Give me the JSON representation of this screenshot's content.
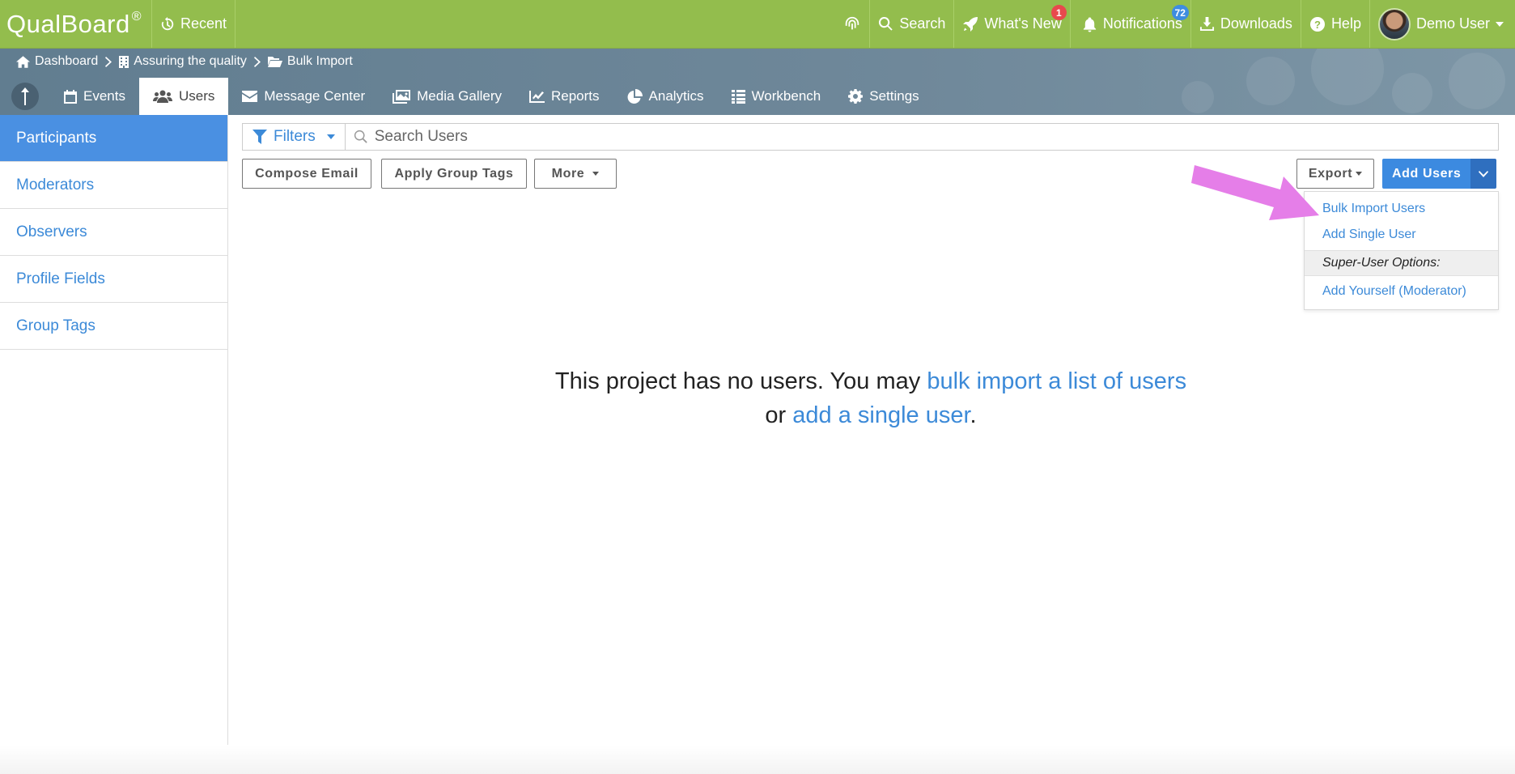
{
  "brand": {
    "name": "QualBoard",
    "mark": "®"
  },
  "topbar": {
    "recent": "Recent",
    "search": "Search",
    "whats_new": "What's New",
    "whats_new_badge": "1",
    "notifications": "Notifications",
    "notifications_badge": "72",
    "downloads": "Downloads",
    "help": "Help",
    "user": "Demo User"
  },
  "breadcrumb": [
    "Dashboard",
    "Assuring the quality",
    "Bulk Import"
  ],
  "nav": {
    "tabs": [
      "Events",
      "Users",
      "Message Center",
      "Media Gallery",
      "Reports",
      "Analytics",
      "Workbench",
      "Settings"
    ],
    "active": "Users"
  },
  "sidebar": {
    "items": [
      "Participants",
      "Moderators",
      "Observers",
      "Profile Fields",
      "Group Tags"
    ],
    "active": "Participants"
  },
  "toolbar": {
    "filters": "Filters",
    "search_placeholder": "Search Users",
    "compose_email": "Compose Email",
    "apply_group_tags": "Apply Group Tags",
    "more": "More",
    "export": "Export",
    "add_users": "Add Users"
  },
  "dropdown": {
    "bulk_import": "Bulk Import Users",
    "add_single": "Add Single User",
    "super_user_header": "Super-User Options:",
    "add_yourself": "Add Yourself (Moderator)"
  },
  "empty_state": {
    "prefix": "This project has no users. You may ",
    "bulk_link": "bulk import a list of users",
    "middle": "or ",
    "single_link": "add a single user",
    "suffix": "."
  },
  "colors": {
    "topbar": "#93bd4d",
    "subbar": "#6f889a",
    "link": "#3c8ad8",
    "primary": "#3c8ae0",
    "arrow": "#e57ee8"
  }
}
